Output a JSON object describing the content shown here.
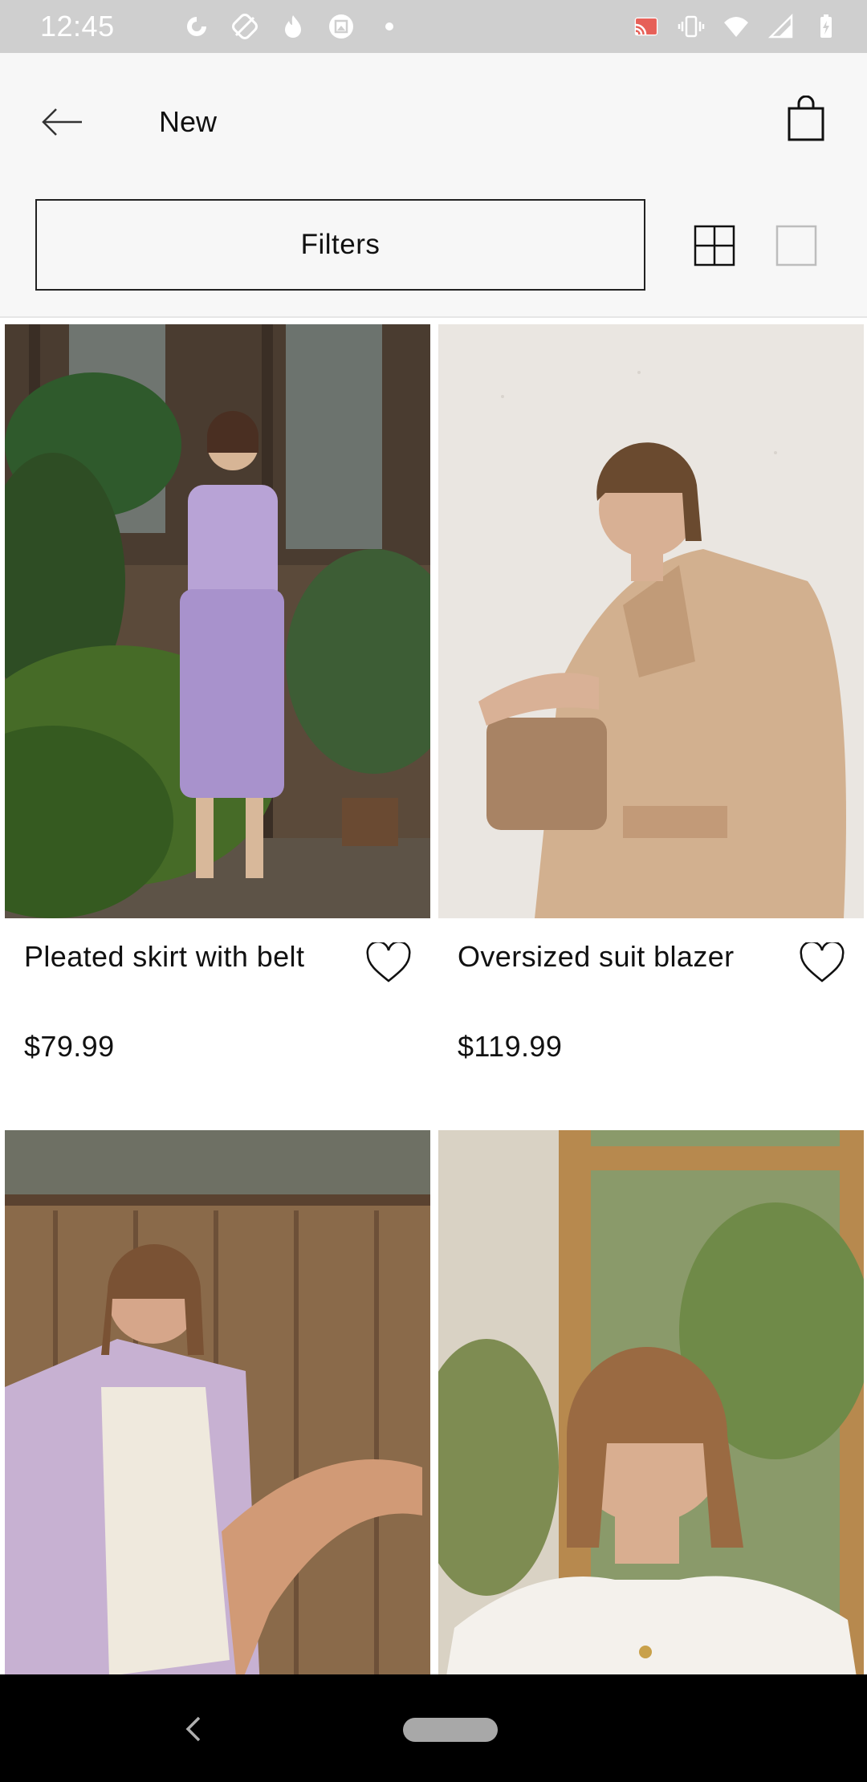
{
  "status_bar": {
    "time": "12:45",
    "left_icons": [
      "data-saver-icon",
      "crossed-app-icon",
      "flame-icon",
      "photo-app-icon",
      "dot-icon"
    ],
    "right_icons": [
      "cast-icon",
      "vibrate-icon",
      "wifi-icon",
      "signal-icon",
      "battery-charging-icon"
    ]
  },
  "header": {
    "title": "New",
    "back_icon": "arrow-left-icon",
    "bag_icon": "shopping-bag-icon"
  },
  "toolbar": {
    "filters_label": "Filters",
    "grid_view_icon": "grid-view-icon",
    "single_view_icon": "single-view-icon"
  },
  "products": [
    {
      "name": "Pleated skirt with belt",
      "price": "$79.99",
      "image": "lilac pleated cardigan and skirt among plants"
    },
    {
      "name": "Oversized suit blazer",
      "price": "$119.99",
      "image": "beige oversized blazer against white wall"
    },
    {
      "name": "",
      "price": "",
      "image": "lilac shirt over cream bodysuit, seated on wood floor"
    },
    {
      "name": "",
      "price": "",
      "image": "white ruffled collar blouse portrait by window"
    }
  ],
  "colors": {
    "header_bg": "#f7f7f7",
    "status_bar_bg": "#cfcfcf",
    "text": "#111111",
    "nav_bar_bg": "#000000"
  }
}
